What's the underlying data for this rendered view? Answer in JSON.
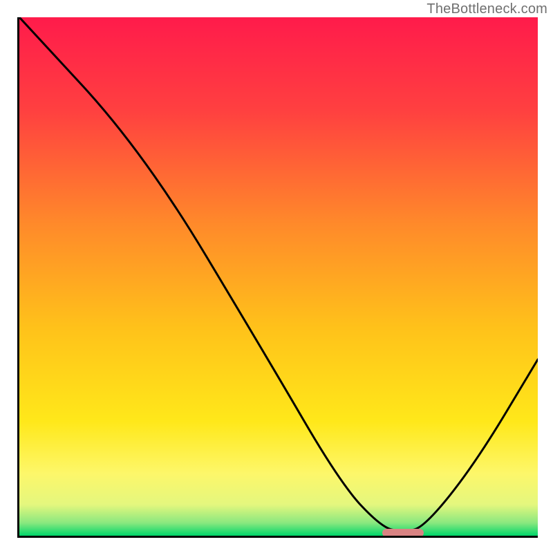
{
  "watermark": "TheBottleneck.com",
  "chart_data": {
    "type": "line",
    "title": "",
    "xlabel": "",
    "ylabel": "",
    "x_range": [
      0,
      100
    ],
    "y_range": [
      0,
      100
    ],
    "curve": [
      {
        "x": 0,
        "y": 100
      },
      {
        "x": 24,
        "y": 74
      },
      {
        "x": 48,
        "y": 34
      },
      {
        "x": 62,
        "y": 10
      },
      {
        "x": 70,
        "y": 1.5
      },
      {
        "x": 74,
        "y": 0.8
      },
      {
        "x": 78,
        "y": 1.5
      },
      {
        "x": 88,
        "y": 14
      },
      {
        "x": 100,
        "y": 34
      }
    ],
    "minimum_marker": {
      "x_start": 70,
      "x_end": 78,
      "y": 0.6
    },
    "gradient_stops": [
      {
        "pos": 0.0,
        "color": "#ff1b4b"
      },
      {
        "pos": 0.18,
        "color": "#ff4040"
      },
      {
        "pos": 0.4,
        "color": "#ff8a2a"
      },
      {
        "pos": 0.6,
        "color": "#ffc21a"
      },
      {
        "pos": 0.78,
        "color": "#ffe81a"
      },
      {
        "pos": 0.88,
        "color": "#fdf76a"
      },
      {
        "pos": 0.94,
        "color": "#e4f77e"
      },
      {
        "pos": 0.975,
        "color": "#8ae87f"
      },
      {
        "pos": 1.0,
        "color": "#00d66a"
      }
    ]
  }
}
